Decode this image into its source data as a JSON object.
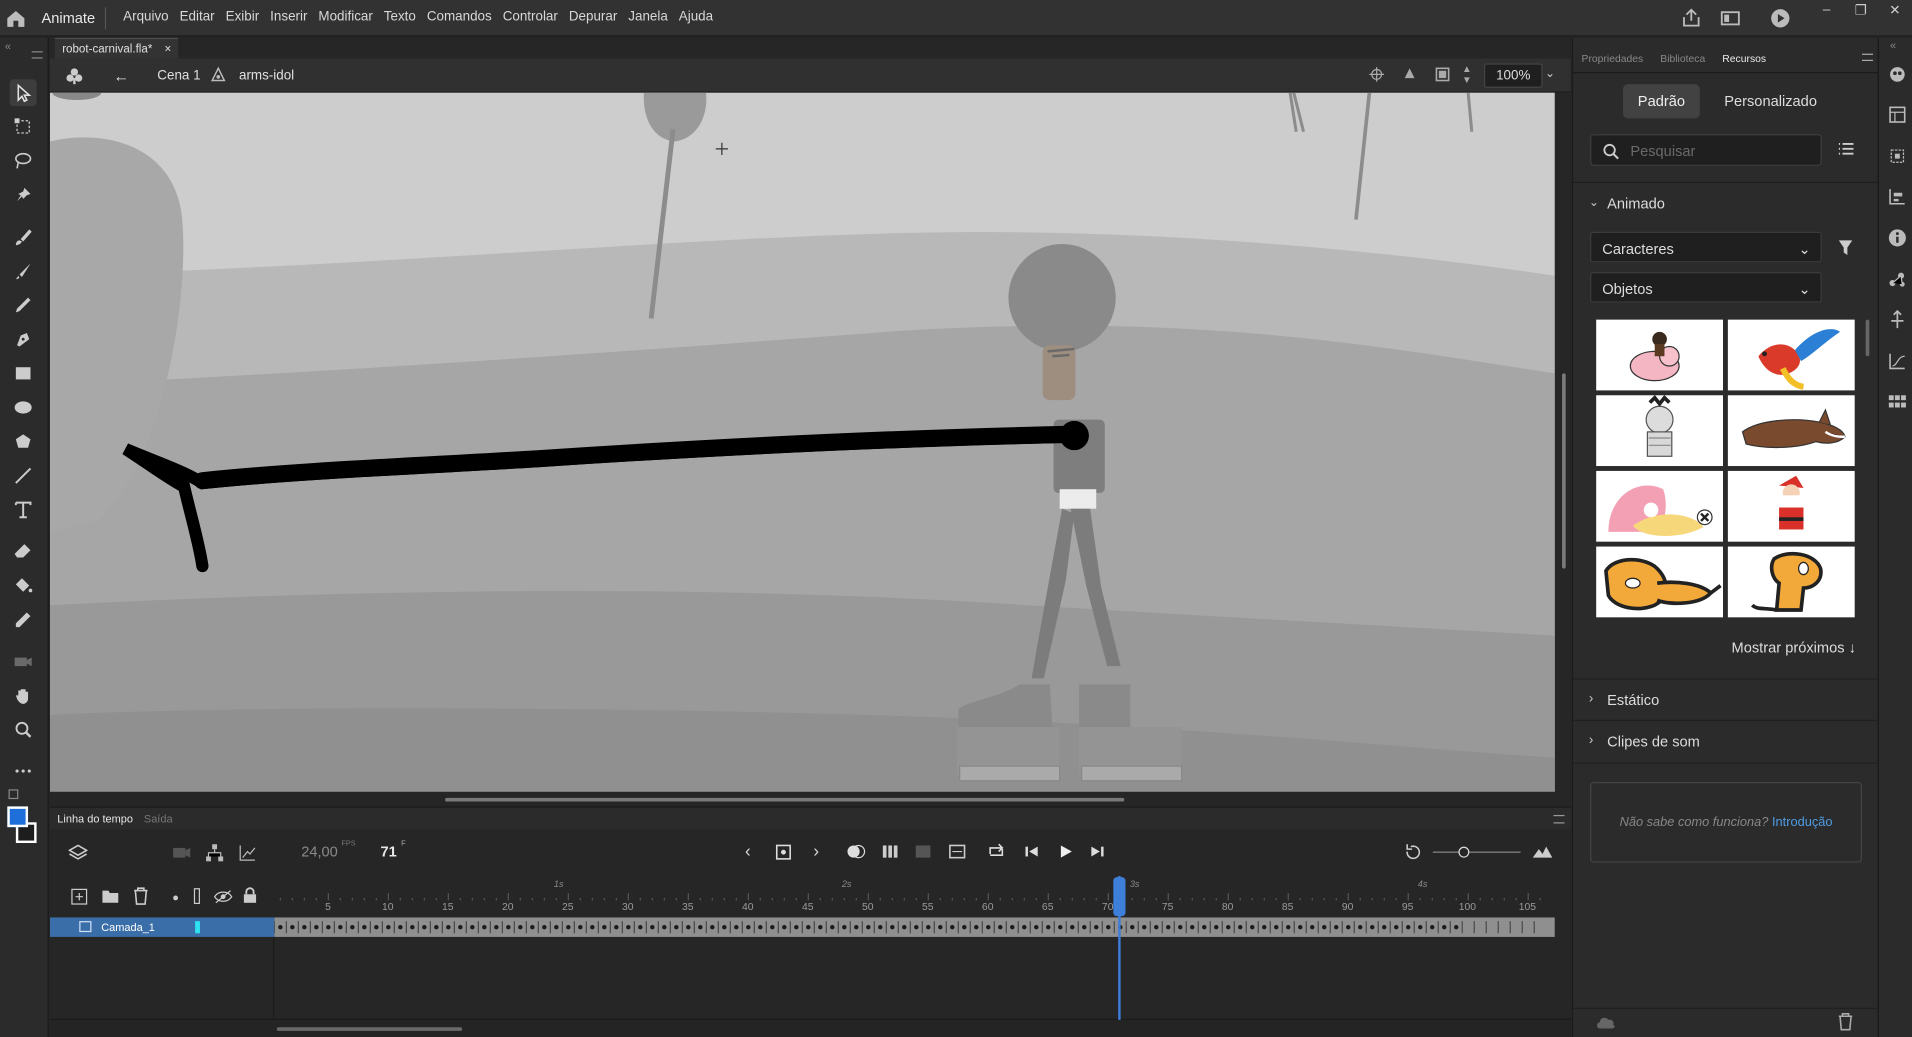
{
  "app": {
    "name": "Animate"
  },
  "menu": [
    "Arquivo",
    "Editar",
    "Exibir",
    "Inserir",
    "Modificar",
    "Texto",
    "Comandos",
    "Controlar",
    "Depurar",
    "Janela",
    "Ajuda"
  ],
  "document": {
    "tab_title": "robot-carnival.fla*",
    "close": "×"
  },
  "editbar": {
    "scene": "Cena 1",
    "symbol": "arms-idol",
    "zoom": "100%"
  },
  "timeline": {
    "tabs": [
      "Linha do tempo",
      "Saída"
    ],
    "fps": "24,00",
    "fps_unit": "FPS",
    "frame": "71",
    "frame_unit": "F",
    "layer_name": "Camada_1",
    "ruler_seconds": [
      "1s",
      "2s",
      "3s",
      "4s"
    ],
    "ruler_frames": [
      "5",
      "10",
      "15",
      "20",
      "25",
      "30",
      "35",
      "40",
      "45",
      "50",
      "55",
      "60",
      "65",
      "70",
      "75",
      "80",
      "85",
      "90",
      "95",
      "100",
      "105"
    ],
    "current_frame": 71
  },
  "right_panel": {
    "tabs": [
      "Propriedades",
      "Biblioteca",
      "Recursos"
    ],
    "active_tab": "Recursos",
    "seg_default": "Padrão",
    "seg_custom": "Personalizado",
    "search_placeholder": "Pesquisar",
    "section_animated": "Animado",
    "dropdown1": "Caracteres",
    "dropdown2": "Objetos",
    "show_more": "Mostrar próximos ↓",
    "section_static": "Estático",
    "section_sounds": "Clipes de som",
    "intro_question": "Não sabe como funciona?",
    "intro_link": "Introdução",
    "thumbnails": [
      "pig-rider",
      "parrot",
      "mummy",
      "wolf",
      "snail",
      "santa",
      "dog-lying",
      "dog-sitting"
    ]
  },
  "colors": {
    "stroke": "#ffffff",
    "fill": "#1e6fd9",
    "accent": "#3d7fd9"
  }
}
